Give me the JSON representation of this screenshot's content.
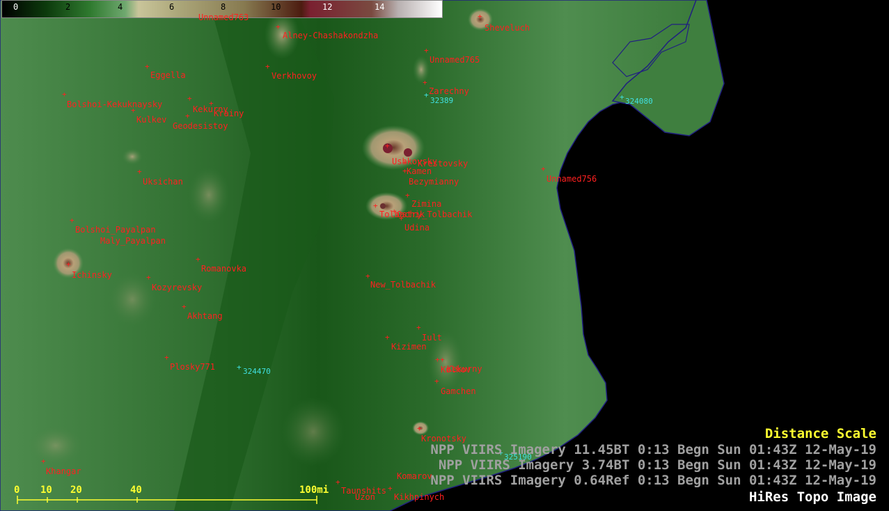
{
  "colorbar": {
    "ticks": [
      "0",
      "2",
      "4",
      "6",
      "8",
      "10",
      "12",
      "14"
    ]
  },
  "volcanoes": [
    {
      "name": "Unnamed763"
    },
    {
      "name": "Alney-Chashakondzha"
    },
    {
      "name": "Sheveluch"
    },
    {
      "name": "Unnamed765"
    },
    {
      "name": "Eggella"
    },
    {
      "name": "Verkhovoy"
    },
    {
      "name": "Zarechny"
    },
    {
      "name": "Bolshoi-Kekuknaysky"
    },
    {
      "name": "Kekurny"
    },
    {
      "name": "Krainy"
    },
    {
      "name": "Kulkev"
    },
    {
      "name": "Geodesistoy"
    },
    {
      "name": "Ushkovsky"
    },
    {
      "name": "Kamen"
    },
    {
      "name": "Krestovsky"
    },
    {
      "name": "Bezymianny"
    },
    {
      "name": "Uksichan"
    },
    {
      "name": "Unnamed756"
    },
    {
      "name": "Zimina"
    },
    {
      "name": "Tolbachik"
    },
    {
      "name": "Ostry_Tolbachik"
    },
    {
      "name": "Udina"
    },
    {
      "name": "Bolshoi_Payalpan"
    },
    {
      "name": "Maly_Payalpan"
    },
    {
      "name": "Romanovka"
    },
    {
      "name": "Ichinsky"
    },
    {
      "name": "Kozyrevsky"
    },
    {
      "name": "New_Tolbachik"
    },
    {
      "name": "Akhtang"
    },
    {
      "name": "Iult"
    },
    {
      "name": "Kizimen"
    },
    {
      "name": "Plosky771"
    },
    {
      "name": "Kulkov"
    },
    {
      "name": "Kekurny"
    },
    {
      "name": "Gamchen"
    },
    {
      "name": "Kronotsky"
    },
    {
      "name": "Khangar"
    },
    {
      "name": "Taunshits"
    },
    {
      "name": "Uzon"
    },
    {
      "name": "Kikhpinych"
    },
    {
      "name": "Komarov"
    }
  ],
  "stations": [
    {
      "id": "32389"
    },
    {
      "id": "324080"
    },
    {
      "id": "324470"
    },
    {
      "id": "325190"
    }
  ],
  "imagery_lines": [
    "NPP VIIRS Imagery 11.45BT  0:13 Begn Sun 01:43Z 12-May-19",
    "NPP VIIRS Imagery 3.74BT  0:13 Begn Sun 01:43Z 12-May-19",
    "NPP VIIRS Imagery 0.64Ref  0:13 Begn Sun 01:43Z 12-May-19"
  ],
  "distance_scale": {
    "title": "Distance Scale",
    "labels": [
      "0",
      "10",
      "20",
      "40",
      "100mi"
    ]
  },
  "image_label": "HiRes Topo Image",
  "colors": {
    "volcano_label": "#ff2020",
    "station_label": "#40e0e0",
    "scale": "#ffff30",
    "ocean": "#000000",
    "land_low": "#1f5f1f",
    "coastline": "#202080"
  }
}
